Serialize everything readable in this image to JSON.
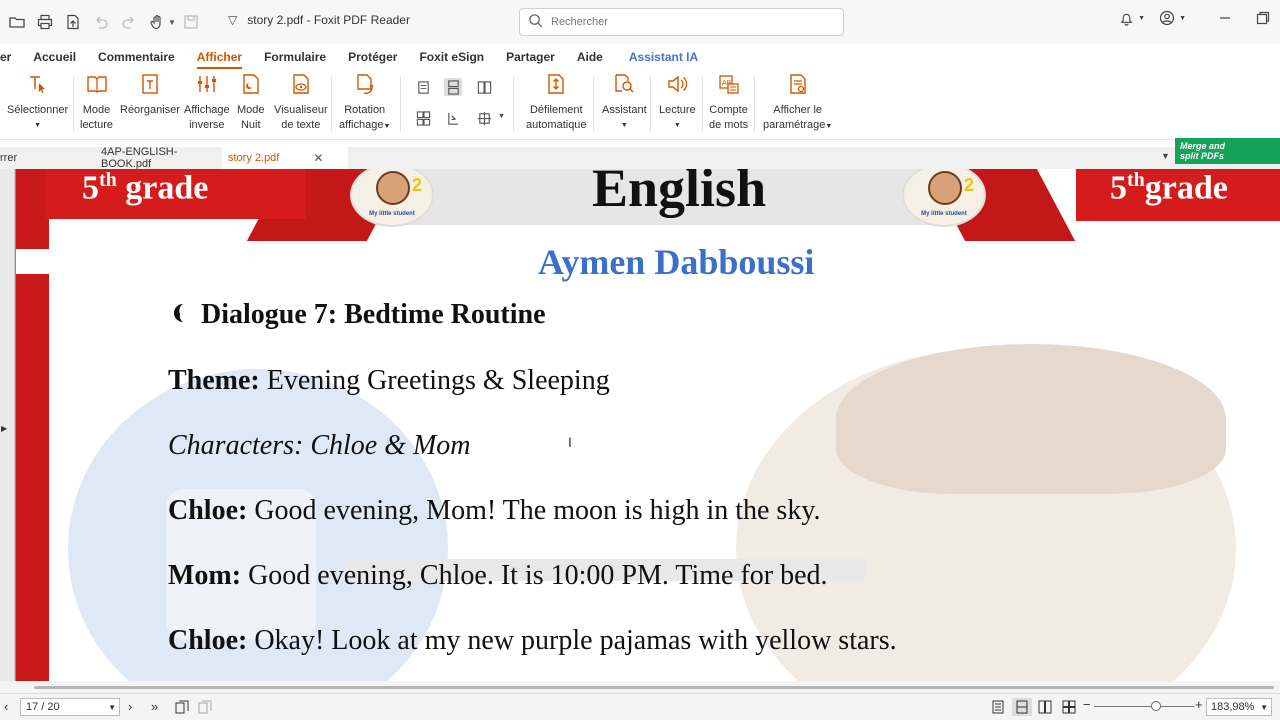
{
  "titlebar": {
    "title": "story 2.pdf - Foxit PDF Reader",
    "search_placeholder": "Rechercher"
  },
  "menu": {
    "tabs": [
      {
        "label": "er"
      },
      {
        "label": "Accueil"
      },
      {
        "label": "Commentaire"
      },
      {
        "label": "Afficher"
      },
      {
        "label": "Formulaire"
      },
      {
        "label": "Protéger"
      },
      {
        "label": "Foxit eSign"
      },
      {
        "label": "Partager"
      },
      {
        "label": "Aide"
      },
      {
        "label": "Assistant IA"
      }
    ],
    "active": "Afficher"
  },
  "ribbon": {
    "select": {
      "line1": "Sélectionner"
    },
    "reading_mode": {
      "line1": "Mode",
      "line2": "lecture"
    },
    "reorganize": {
      "line1": "Réorganiser"
    },
    "reverse_view": {
      "line1": "Affichage",
      "line2": "inverse"
    },
    "night_mode": {
      "line1": "Mode",
      "line2": "Nuit"
    },
    "text_viewer": {
      "line1": "Visualiseur",
      "line2": "de texte"
    },
    "rotate_view": {
      "line1": "Rotation",
      "line2": "affichage"
    },
    "auto_scroll": {
      "line1": "Défilement",
      "line2": "automatique"
    },
    "assistant": {
      "line1": "Assistant"
    },
    "read": {
      "line1": "Lecture"
    },
    "word_count": {
      "line1": "Compte",
      "line2": "de mots"
    },
    "settings": {
      "line1": "Afficher le",
      "line2": "paramétrage"
    }
  },
  "doctabs": {
    "partial": "rrer",
    "tab1": "4AP-ENGLISH-BOOK.pdf",
    "tab2": "story 2.pdf",
    "promo_line1": "Merge and",
    "promo_line2": "split PDFs"
  },
  "document": {
    "grade_left_num": "5",
    "grade_left_sup": "th",
    "grade_left_word": "grade",
    "grade_right_num": "5",
    "grade_right_sup": "th",
    "grade_right_word": "grade",
    "logo_text": "My little student",
    "logo_num": "2",
    "title": "English",
    "author": "Aymen Dabboussi",
    "dialogue_title": "Dialogue 7: Bedtime Routine",
    "theme_label": "Theme:",
    "theme_value": " Evening Greetings & Sleeping",
    "characters": "Characters: Chloe & Mom",
    "line1_speaker": "Chloe:",
    "line1_text": " Good evening, Mom! The moon is high in the sky.",
    "line2_speaker": "Mom:",
    "line2_text": " Good evening, Chloe. It is 10:00 PM. Time for bed.",
    "line3_speaker": "Chloe:",
    "line3_text": " Okay! Look at my new purple pajamas with yellow stars."
  },
  "statusbar": {
    "page": "17 / 20",
    "zoom": "183,98%"
  }
}
